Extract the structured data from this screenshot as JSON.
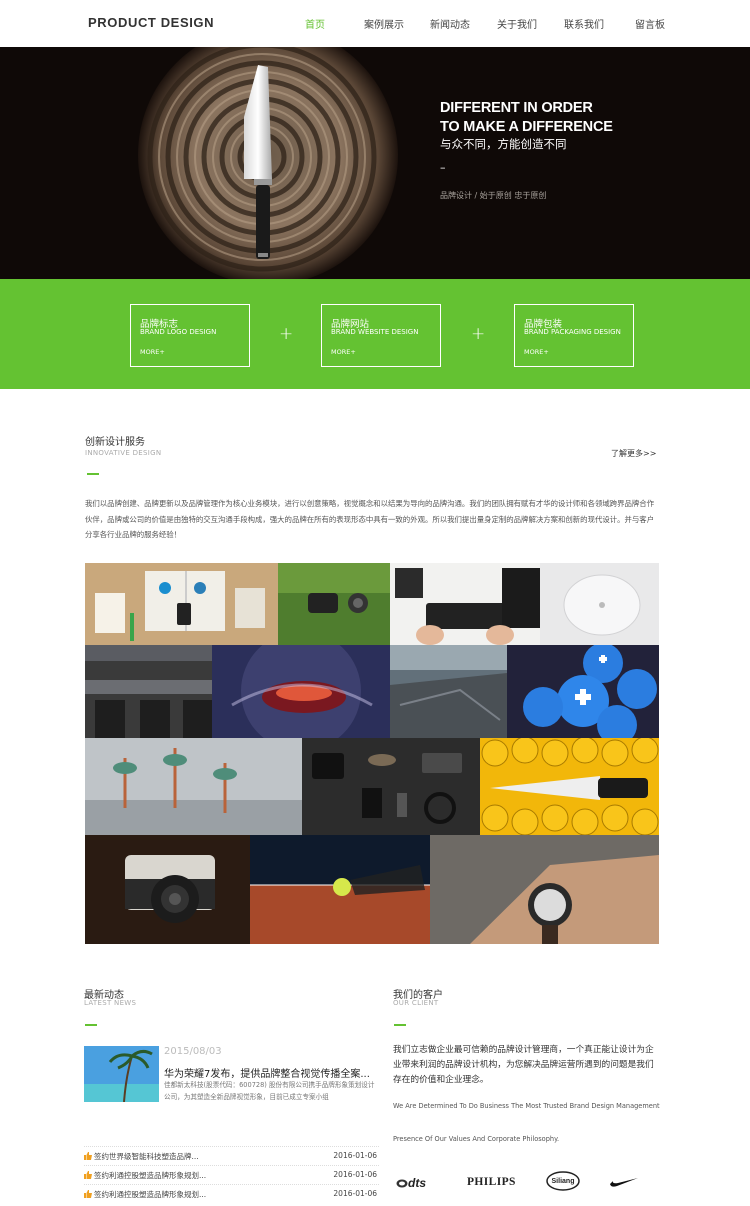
{
  "header": {
    "logo": "PRODUCT DESIGN",
    "nav": [
      "首页",
      "案例展示",
      "新闻动态",
      "关于我们",
      "联系我们",
      "留言板"
    ],
    "active_index": 0
  },
  "hero": {
    "title_line1": "DIFFERENT IN ORDER",
    "title_line2": "TO MAKE A DIFFERENCE",
    "title_cn": "与众不同，方能创造不同",
    "dash": "–",
    "subtitle": "品牌设计 / 始于原创 忠于原创"
  },
  "services": [
    {
      "title": "品牌标志",
      "en": "BRAND LOGO DESIGN",
      "more": "MORE+"
    },
    {
      "title": "品牌网站",
      "en": "BRAND WEBSITE DESIGN",
      "more": "MORE+"
    },
    {
      "title": "品牌包装",
      "en": "BRAND PACKAGING DESIGN",
      "more": "MORE+"
    }
  ],
  "plus_sign": "+",
  "innovative": {
    "title": "创新设计服务",
    "subtitle": "INNOVATIVE DESIGN",
    "more": "了解更多>>",
    "intro": "我们以品牌创建、品牌更新以及品牌管理作为核心业务模块，进行以创意策略，视觉概念和以结果为导向的品牌沟通。我们的团队拥有赋有才华的设计师和各领域跨界品牌合作伙伴，品牌或公司的价值是由独特的交互沟通手段构成，强大的品牌在所有的表现形态中具有一致的外观。所以我们提出量身定制的品牌解决方案和创新的现代设计。并与客户分享各行业品牌的服务经验！"
  },
  "news": {
    "title": "最新动态",
    "subtitle": "LATEST NEWS",
    "featured": {
      "date": "2015/08/03",
      "headline": "华为荣耀7发布，提供品牌整合视觉传播全案...",
      "body": "佳都新太科技(股票代码：600728) 股份有限公司携手品牌形象策划设计公司，为其塑造全新品牌视觉形象，目前已成立专案小组"
    },
    "items": [
      {
        "title": "签约世界级智能科技塑造品牌...",
        "date": "2016-01-06"
      },
      {
        "title": "签约利通控股塑造品牌形象规划...",
        "date": "2016-01-06"
      },
      {
        "title": "签约利通控股塑造品牌形象规划...",
        "date": "2016-01-06"
      }
    ]
  },
  "client": {
    "title": "我们的客户",
    "subtitle": "OUR CLIENT",
    "text": "我们立志做企业最可信赖的品牌设计管理商，一个真正能让设计为企业带来利润的品牌设计机构，为您解决品牌运营所遇到的问题是我们存在的价值和企业理念。",
    "en_line1": "We Are Determined To Do Business The Most Trusted Brand Design Management",
    "en_line2": "Presence Of Our Values And Corporate Philosophy.",
    "brands": [
      "dts",
      "PHILIPS",
      "Siliang",
      "nike-swoosh"
    ]
  },
  "colors": {
    "accent": "#64c232",
    "hero_bg": "#0f0907",
    "text": "#333333"
  }
}
